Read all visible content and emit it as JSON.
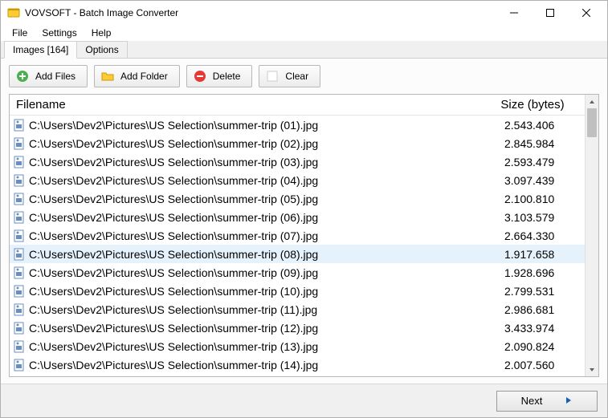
{
  "title": "VOVSOFT - Batch Image Converter",
  "menu": {
    "file": "File",
    "settings": "Settings",
    "help": "Help"
  },
  "tabs": {
    "images": "Images [164]",
    "options": "Options"
  },
  "toolbar": {
    "add_files": "Add Files",
    "add_folder": "Add Folder",
    "delete": "Delete",
    "clear": "Clear"
  },
  "columns": {
    "filename": "Filename",
    "size": "Size (bytes)"
  },
  "rows": [
    {
      "fn": "C:\\Users\\Dev2\\Pictures\\US Selection\\summer-trip (01).jpg",
      "sz": "2.543.406",
      "sel": false
    },
    {
      "fn": "C:\\Users\\Dev2\\Pictures\\US Selection\\summer-trip (02).jpg",
      "sz": "2.845.984",
      "sel": false
    },
    {
      "fn": "C:\\Users\\Dev2\\Pictures\\US Selection\\summer-trip (03).jpg",
      "sz": "2.593.479",
      "sel": false
    },
    {
      "fn": "C:\\Users\\Dev2\\Pictures\\US Selection\\summer-trip (04).jpg",
      "sz": "3.097.439",
      "sel": false
    },
    {
      "fn": "C:\\Users\\Dev2\\Pictures\\US Selection\\summer-trip (05).jpg",
      "sz": "2.100.810",
      "sel": false
    },
    {
      "fn": "C:\\Users\\Dev2\\Pictures\\US Selection\\summer-trip (06).jpg",
      "sz": "3.103.579",
      "sel": false
    },
    {
      "fn": "C:\\Users\\Dev2\\Pictures\\US Selection\\summer-trip (07).jpg",
      "sz": "2.664.330",
      "sel": false
    },
    {
      "fn": "C:\\Users\\Dev2\\Pictures\\US Selection\\summer-trip (08).jpg",
      "sz": "1.917.658",
      "sel": true
    },
    {
      "fn": "C:\\Users\\Dev2\\Pictures\\US Selection\\summer-trip (09).jpg",
      "sz": "1.928.696",
      "sel": false
    },
    {
      "fn": "C:\\Users\\Dev2\\Pictures\\US Selection\\summer-trip (10).jpg",
      "sz": "2.799.531",
      "sel": false
    },
    {
      "fn": "C:\\Users\\Dev2\\Pictures\\US Selection\\summer-trip (11).jpg",
      "sz": "2.986.681",
      "sel": false
    },
    {
      "fn": "C:\\Users\\Dev2\\Pictures\\US Selection\\summer-trip (12).jpg",
      "sz": "3.433.974",
      "sel": false
    },
    {
      "fn": "C:\\Users\\Dev2\\Pictures\\US Selection\\summer-trip (13).jpg",
      "sz": "2.090.824",
      "sel": false
    },
    {
      "fn": "C:\\Users\\Dev2\\Pictures\\US Selection\\summer-trip (14).jpg",
      "sz": "2.007.560",
      "sel": false
    }
  ],
  "footer": {
    "next": "Next"
  }
}
